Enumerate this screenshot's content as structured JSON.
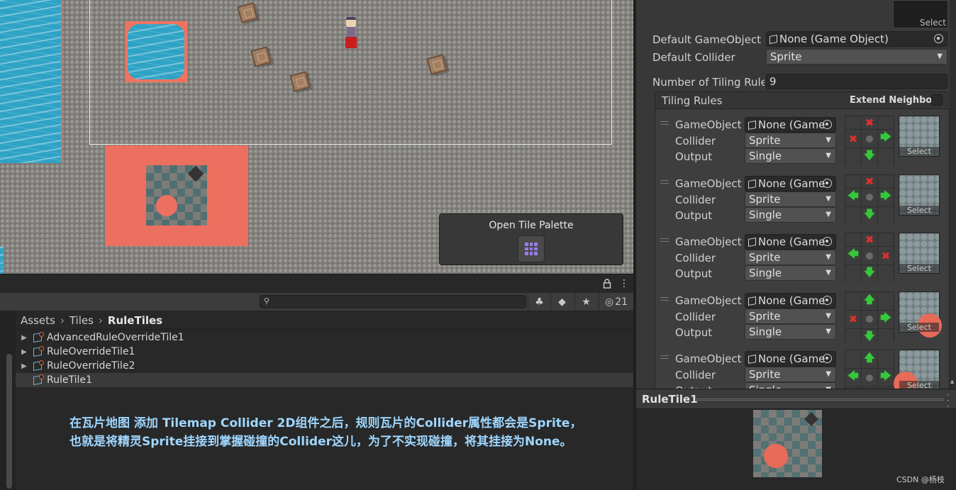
{
  "scene": {
    "overlay": {
      "title": "Open Tile Palette",
      "icon": "tile-palette-grid-icon"
    }
  },
  "project": {
    "search": {
      "placeholder": ""
    },
    "hidden_count": "21",
    "breadcrumb": [
      "Assets",
      "Tiles",
      "RuleTiles"
    ],
    "assets": [
      {
        "name": "AdvancedRuleOverrideTile1",
        "expandable": true,
        "selected": false
      },
      {
        "name": "RuleOverrideTile1",
        "expandable": true,
        "selected": false
      },
      {
        "name": "RuleOverrideTile2",
        "expandable": true,
        "selected": false
      },
      {
        "name": "RuleTile1",
        "expandable": false,
        "selected": true
      }
    ],
    "caption": [
      "在瓦片地图 添加 Tilemap Collider 2D组件之后，规则瓦片的Collider属性都会是Sprite，",
      "也就是将精灵Sprite挂接到掌握碰撞的Collider这儿，为了不实现碰撞，将其挂接为None。"
    ]
  },
  "inspector": {
    "top_preview_select": "Select",
    "default_gameobject_label": "Default GameObject",
    "default_gameobject_value": "None (Game Object)",
    "default_collider_label": "Default Collider",
    "default_collider_value": "Sprite",
    "tiling_rules_count_label": "Number of Tiling Rules",
    "tiling_rules_count_value": "9",
    "tiling_rules_header": "Tiling Rules",
    "extend_neighbor_label": "Extend Neighbor",
    "rule_labels": {
      "gameobject": "GameObject",
      "collider": "Collider",
      "output": "Output"
    },
    "rules": [
      {
        "gameobject": "None (Game",
        "collider": "Sprite",
        "output": "Single",
        "select": "Select",
        "grid": [
          "",
          "x",
          "",
          "x",
          "c",
          "right",
          "",
          "down",
          ""
        ]
      },
      {
        "gameobject": "None (Game",
        "collider": "Sprite",
        "output": "Single",
        "select": "Select",
        "grid": [
          "",
          "x",
          "",
          "left",
          "c",
          "right",
          "",
          "down",
          ""
        ]
      },
      {
        "gameobject": "None (Game",
        "collider": "Sprite",
        "output": "Single",
        "select": "Select",
        "grid": [
          "",
          "x",
          "",
          "left",
          "c",
          "x",
          "",
          "down",
          ""
        ]
      },
      {
        "gameobject": "None (Game",
        "collider": "Sprite",
        "output": "Single",
        "select": "Select",
        "grid": [
          "",
          "up",
          "",
          "x",
          "c",
          "right",
          "",
          "down",
          ""
        ]
      },
      {
        "gameobject": "None (Game",
        "collider": "Sprite",
        "output": "Single",
        "select": "Select",
        "grid": [
          "",
          "up",
          "",
          "left",
          "c",
          "right",
          "",
          "down",
          ""
        ]
      }
    ]
  },
  "preview": {
    "asset_name": "RuleTile1",
    "watermark": "CSDN @杨枝"
  },
  "colors": {
    "accent_salmon": "#ec705f",
    "water": "#2fa3c6",
    "panel_bg": "#383838",
    "caption": "#9fd6ff"
  }
}
